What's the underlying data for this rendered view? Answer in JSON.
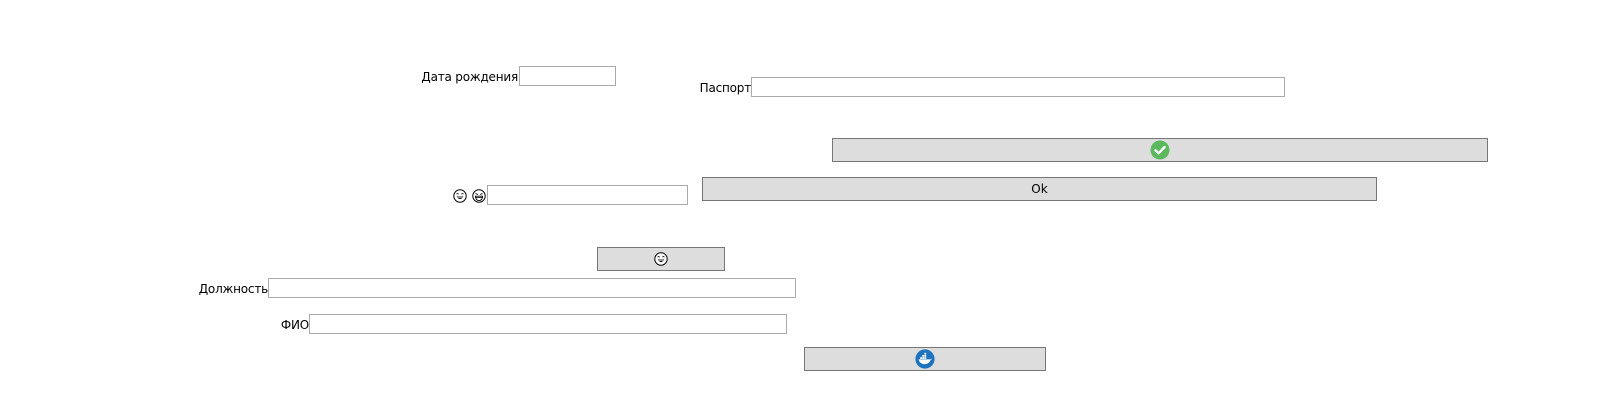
{
  "form": {
    "birth_date": {
      "label": "Дата рождения",
      "value": ""
    },
    "passport": {
      "label": "Паспорт",
      "value": ""
    },
    "emoji_field": {
      "value": ""
    },
    "position": {
      "label": "Должность",
      "value": ""
    },
    "full_name": {
      "label": "ФИО",
      "value": ""
    }
  },
  "buttons": {
    "confirm": {
      "icon": "check-circle-icon",
      "color": "#5cb85c"
    },
    "ok": {
      "label": "Ok"
    },
    "emoji": {
      "icon": "laughing-face-icon"
    },
    "docker": {
      "icon": "docker-whale-icon",
      "color": "#1e73be"
    }
  },
  "emoji_labels": [
    "laughing-face-icon",
    "grinning-face-icon"
  ]
}
